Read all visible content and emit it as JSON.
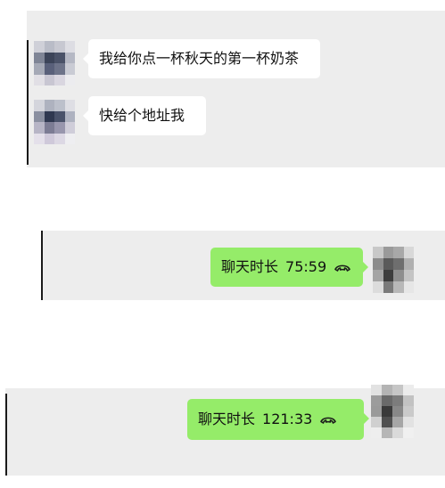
{
  "conversation": {
    "messages": [
      {
        "sender": "contact",
        "text": "我给你点一杯秋天的第一杯奶茶"
      },
      {
        "sender": "contact",
        "text": "快给个地址我"
      },
      {
        "sender": "self",
        "call_label": "聊天时长",
        "duration": "75:59",
        "icon": "phone-hangup-icon"
      },
      {
        "sender": "self",
        "call_label": "聊天时长",
        "duration": "121:33",
        "icon": "phone-hangup-icon"
      }
    ]
  },
  "colors": {
    "chat_background": "#ededed",
    "incoming_bubble": "#ffffff",
    "outgoing_bubble": "#95ec69",
    "text": "#111111"
  }
}
